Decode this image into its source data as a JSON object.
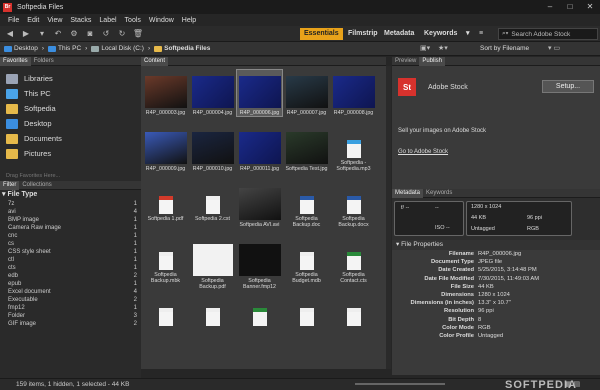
{
  "window": {
    "title": "Softpedia Files",
    "app_icon": "Br",
    "controls": [
      "–",
      "□",
      "✕"
    ]
  },
  "menu": [
    "File",
    "Edit",
    "View",
    "Stacks",
    "Label",
    "Tools",
    "Window",
    "Help"
  ],
  "workspaces": {
    "items": [
      "Essentials",
      "Filmstrip",
      "Metadata",
      "Keywords"
    ],
    "active": "Essentials"
  },
  "search": {
    "placeholder": "Search Adobe Stock"
  },
  "breadcrumb": [
    "Desktop",
    "This PC",
    "Local Disk (C:)",
    "Softpedia Files"
  ],
  "sort": {
    "label": "Sort by Filename"
  },
  "left": {
    "tabs": [
      "Favorites",
      "Folders"
    ],
    "favorites": [
      {
        "label": "Libraries",
        "icon": "libraries-icon",
        "color": "#9aa3b5"
      },
      {
        "label": "This PC",
        "icon": "computer-icon",
        "color": "#4aa3e8"
      },
      {
        "label": "Softpedia",
        "icon": "folder-icon",
        "color": "#e6b94a"
      },
      {
        "label": "Desktop",
        "icon": "desktop-icon",
        "color": "#3b8ee0"
      },
      {
        "label": "Documents",
        "icon": "documents-icon",
        "color": "#e6b94a"
      },
      {
        "label": "Pictures",
        "icon": "pictures-icon",
        "color": "#e6b94a"
      }
    ],
    "drag_hint": "Drag Favorites Here...",
    "filter_tabs": [
      "Filter",
      "Collections"
    ],
    "filter_header": "File Type",
    "filters": [
      {
        "label": "7z",
        "count": "1"
      },
      {
        "label": "avi",
        "count": "4"
      },
      {
        "label": "BMP image",
        "count": "1"
      },
      {
        "label": "Camera Raw image",
        "count": "1"
      },
      {
        "label": "cnc",
        "count": "1"
      },
      {
        "label": "cs",
        "count": "1"
      },
      {
        "label": "CSS style sheet",
        "count": "1"
      },
      {
        "label": "ctl",
        "count": "1"
      },
      {
        "label": "cts",
        "count": "1"
      },
      {
        "label": "edb",
        "count": "2"
      },
      {
        "label": "epub",
        "count": "1"
      },
      {
        "label": "Excel document",
        "count": "4"
      },
      {
        "label": "Executable",
        "count": "2"
      },
      {
        "label": "fmp12",
        "count": "1"
      },
      {
        "label": "Folder",
        "count": "3"
      },
      {
        "label": "GIF image",
        "count": "2"
      }
    ]
  },
  "content": {
    "tab": "Content",
    "thumbs": [
      {
        "label": "R4P_000003.jpg",
        "kind": "photo",
        "color": "#6b3a2a"
      },
      {
        "label": "R4P_000004.jpg",
        "kind": "softpedia",
        "color": "#1a2a8a"
      },
      {
        "label": "R4P_000006.jpg",
        "kind": "softpedia",
        "color": "#1a2a8a"
      },
      {
        "label": "R4P_000007.jpg",
        "kind": "photo",
        "color": "#283a48"
      },
      {
        "label": "R4P_000008.jpg",
        "kind": "softpedia",
        "color": "#1a2a8a"
      },
      {
        "label": "R4P_000009.jpg",
        "kind": "photo",
        "color": "#3a5ab8"
      },
      {
        "label": "R4P_000010.jpg",
        "kind": "photo",
        "color": "#1a2540"
      },
      {
        "label": "R4P_000011.jpg",
        "kind": "softpedia",
        "color": "#1a2a8a"
      },
      {
        "label": "Softpedia Test.jpg",
        "kind": "photo",
        "color": "#2a3a2a"
      },
      {
        "label": "Softpedia - Softpedia.mp3",
        "kind": "file",
        "color": "#3aa0e0"
      },
      {
        "label": "Softpedia 1.pdf",
        "kind": "file",
        "color": "#d23a2a"
      },
      {
        "label": "Softpedia 2.cst",
        "kind": "file",
        "color": "#eeeeee"
      },
      {
        "label": "Softpedia AVI.avi",
        "kind": "photo",
        "color": "#444444"
      },
      {
        "label": "Softpedia Backup.doc",
        "kind": "file",
        "color": "#2a5aa8"
      },
      {
        "label": "Softpedia Backup.docx",
        "kind": "file",
        "color": "#2a5aa8"
      },
      {
        "label": "Softpedia Backup.mbk",
        "kind": "file",
        "color": "#eeeeee"
      },
      {
        "label": "Softpedia Backup.pdf",
        "kind": "paper",
        "color": "#f2f2f2"
      },
      {
        "label": "Softpedia Banner.fmp12",
        "kind": "photo",
        "color": "#111111"
      },
      {
        "label": "Softpedia Budget.mdb",
        "kind": "file",
        "color": "#eeeeee"
      },
      {
        "label": "Softpedia Contact.cts",
        "kind": "file",
        "color": "#2a8a3a"
      },
      {
        "label": "",
        "kind": "file",
        "color": "#eeeeee"
      },
      {
        "label": "",
        "kind": "file",
        "color": "#eeeeee"
      },
      {
        "label": "",
        "kind": "file",
        "color": "#2a8a3a"
      },
      {
        "label": "",
        "kind": "file",
        "color": "#eeeeee"
      },
      {
        "label": "",
        "kind": "file",
        "color": "#eeeeee"
      }
    ]
  },
  "right": {
    "preview_tabs": [
      "Preview",
      "Publish"
    ],
    "stock": {
      "logo": "St",
      "name": "Adobe Stock",
      "button": "Setup...",
      "sell": "Sell your images on Adobe Stock",
      "link": "Go to Adobe Stock"
    },
    "meta_tabs": [
      "Metadata",
      "Keywords"
    ],
    "camera": {
      "f": "f/ --",
      "shutter": "--",
      "iso": "ISO --"
    },
    "image_info": {
      "dims": "1280 x 1024",
      "size": "44 KB",
      "ppi": "96 ppi",
      "tag": "Untagged",
      "mode": "RGB"
    },
    "props_header": "File Properties",
    "props": [
      {
        "k": "Filename",
        "v": "R4P_000006.jpg"
      },
      {
        "k": "Document Type",
        "v": "JPEG file"
      },
      {
        "k": "Date Created",
        "v": "5/25/2015, 3:14:48 PM"
      },
      {
        "k": "Date File Modified",
        "v": "7/30/2015, 11:49:03 AM"
      },
      {
        "k": "File Size",
        "v": "44 KB"
      },
      {
        "k": "Dimensions",
        "v": "1280 x 1024"
      },
      {
        "k": "Dimensions (in inches)",
        "v": "13.3\" x 10.7\""
      },
      {
        "k": "Resolution",
        "v": "96 ppi"
      },
      {
        "k": "Bit Depth",
        "v": "8"
      },
      {
        "k": "Color Mode",
        "v": "RGB"
      },
      {
        "k": "Color Profile",
        "v": "Untagged"
      }
    ]
  },
  "status": {
    "text": "159 items, 1 hidden, 1 selected - 44 KB"
  },
  "watermark": "SOFTPEDIA",
  "colors": {
    "accent": "#e8a21a",
    "stock": "#d7322d"
  }
}
